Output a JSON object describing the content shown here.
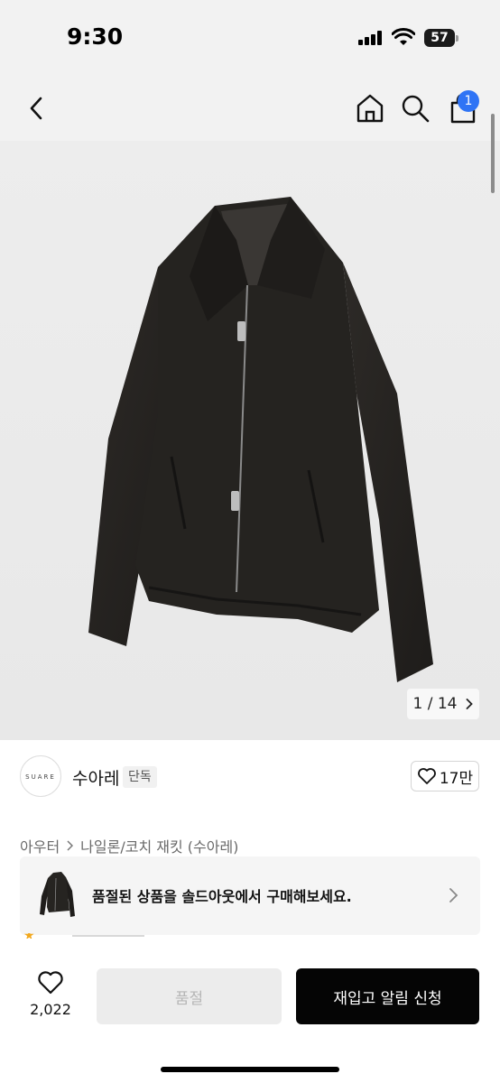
{
  "status_bar": {
    "time": "9:30",
    "battery": "57"
  },
  "nav": {
    "cart_count": "1"
  },
  "gallery": {
    "current": "1 / 14",
    "position": 1,
    "total": 14
  },
  "brand": {
    "logo_text": "SUARE",
    "name": "수아레",
    "tag": "단독",
    "likes": "17만"
  },
  "breadcrumb": {
    "items": [
      "아우터",
      "나일론/코치 재킷 (수아레)"
    ]
  },
  "soldout_banner": {
    "message": "품절된 상품을 솔드아웃에서 구매해보세요."
  },
  "bottom": {
    "wish_count": "2,022",
    "soldout_label": "품절",
    "restock_label": "재입고 알림 신청"
  },
  "colors": {
    "badge_blue": "#2f74f5",
    "cta_black": "#050505",
    "disabled_gray": "#ececec"
  },
  "icons": [
    "back-arrow-icon",
    "home-icon",
    "search-icon",
    "cart-icon",
    "chevron-right-icon",
    "heart-icon",
    "jacket-image"
  ]
}
